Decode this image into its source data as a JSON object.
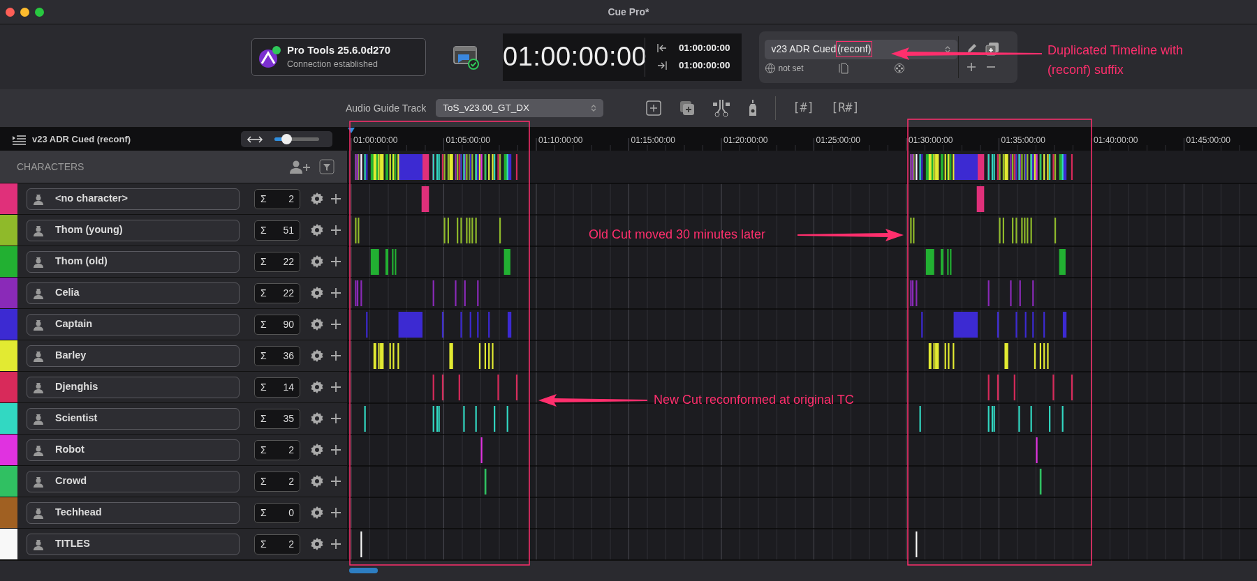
{
  "window": {
    "title": "Cue Pro*"
  },
  "connection": {
    "app": "Pro Tools 25.6.0d270",
    "status": "Connection established",
    "connected": true
  },
  "timecode": {
    "main": "01:00:00:00",
    "in": "01:00:00:00",
    "out": "01:00:00:00"
  },
  "timeline_select": {
    "value": "v23 ADR Cued",
    "suffix": "(reconf)",
    "suffix_boxed": true,
    "language": "not set"
  },
  "guide_track": {
    "label": "Audio Guide Track",
    "value": "ToS_v23.00_GT_DX"
  },
  "text_buttons": [
    "[#]",
    "[R#]"
  ],
  "timeline_header": {
    "title": "v23 ADR Cued (reconf)",
    "zoom": {
      "level": 0.27
    }
  },
  "ruler": {
    "ticks": [
      "01:00:00:00",
      "01:05:00:00",
      "01:10:00:00",
      "01:15:00:00",
      "01:20:00:00",
      "01:25:00:00",
      "01:30:00:00",
      "01:35:00:00",
      "01:40:00:00",
      "01:45:00:00"
    ]
  },
  "characters": {
    "header": "CHARACTERS",
    "rows": [
      {
        "name": "<no character>",
        "total_symbol": "Σ",
        "count": "2",
        "color": "#e0307a"
      },
      {
        "name": "Thom (young)",
        "total_symbol": "Σ",
        "count": "51",
        "color": "#8fba2a"
      },
      {
        "name": "Thom (old)",
        "total_symbol": "Σ",
        "count": "22",
        "color": "#22b032"
      },
      {
        "name": "Celia",
        "total_symbol": "Σ",
        "count": "22",
        "color": "#8a2ab8"
      },
      {
        "name": "Captain",
        "total_symbol": "Σ",
        "count": "90",
        "color": "#3c2ad2"
      },
      {
        "name": "Barley",
        "total_symbol": "Σ",
        "count": "36",
        "color": "#e2ea32"
      },
      {
        "name": "Djenghis",
        "total_symbol": "Σ",
        "count": "14",
        "color": "#d82a5a"
      },
      {
        "name": "Scientist",
        "total_symbol": "Σ",
        "count": "35",
        "color": "#32d8c2"
      },
      {
        "name": "Robot",
        "total_symbol": "Σ",
        "count": "2",
        "color": "#e032e0"
      },
      {
        "name": "Crowd",
        "total_symbol": "Σ",
        "count": "2",
        "color": "#30c062"
      },
      {
        "name": "Techhead",
        "total_symbol": "Σ",
        "count": "0",
        "color": "#a06022"
      },
      {
        "name": "TITLES",
        "total_symbol": "Σ",
        "count": "2",
        "color": "#f8f8f8"
      }
    ]
  },
  "annotations": [
    {
      "kind": "timeline-callout",
      "lines": [
        "Duplicated Timeline with",
        "(reconf) suffix"
      ]
    },
    {
      "kind": "old-cut",
      "lines": [
        "Old Cut moved 30 minutes later"
      ]
    },
    {
      "kind": "new-cut",
      "lines": [
        "New Cut reconformed at original TC"
      ]
    }
  ]
}
